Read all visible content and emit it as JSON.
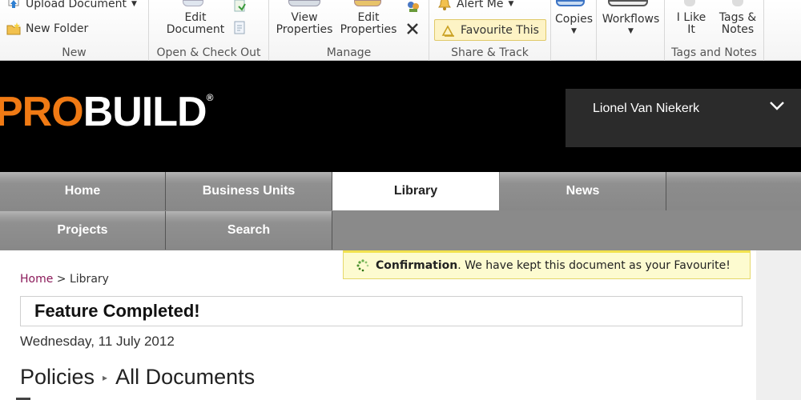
{
  "ribbon": {
    "new_group": {
      "upload_label": "Upload Document",
      "new_folder_label": "New Folder",
      "group_label": "New"
    },
    "open_group": {
      "edit_document_label_1": "Edit",
      "edit_document_label_2": "Document",
      "group_label": "Open & Check Out"
    },
    "manage_group": {
      "view_properties_1": "View",
      "view_properties_2": "Properties",
      "edit_properties_1": "Edit",
      "edit_properties_2": "Properties",
      "group_label": "Manage"
    },
    "share_group": {
      "alert_me_label": "Alert Me",
      "favourite_label": "Favourite This",
      "group_label": "Share & Track"
    },
    "copies_label": "Copies",
    "workflows_label": "Workflows",
    "tags_group": {
      "i_like_1": "I Like",
      "i_like_2": "It",
      "tags_notes_1": "Tags &",
      "tags_notes_2": "Notes",
      "group_label": "Tags and Notes"
    }
  },
  "banner": {
    "logo_pro": "PRO",
    "logo_build": "BUILD",
    "logo_mark": "®",
    "user_name": "Lionel Van Niekerk",
    "user_chevron_icon": "chevron-down-icon"
  },
  "nav": {
    "home": "Home",
    "business_units": "Business Units",
    "library": "Library",
    "news": "News",
    "projects": "Projects",
    "search": "Search"
  },
  "confirmation": {
    "title": "Confirmation",
    "message": ". We have kept this document as your Favourite!"
  },
  "breadcrumb": {
    "home": "Home",
    "separator": ">",
    "current": "Library"
  },
  "feature_title": "Feature Completed!",
  "date": "Wednesday, 11 July 2012",
  "page_heading": {
    "list": "Policies",
    "separator": "▸",
    "view": "All Documents"
  },
  "colors": {
    "brand_orange": "#f07a14",
    "favourite_highlight": "#fdf3c5",
    "confirmation_bg": "#fdfbd0",
    "breadcrumb_link": "#8b1a5a"
  }
}
